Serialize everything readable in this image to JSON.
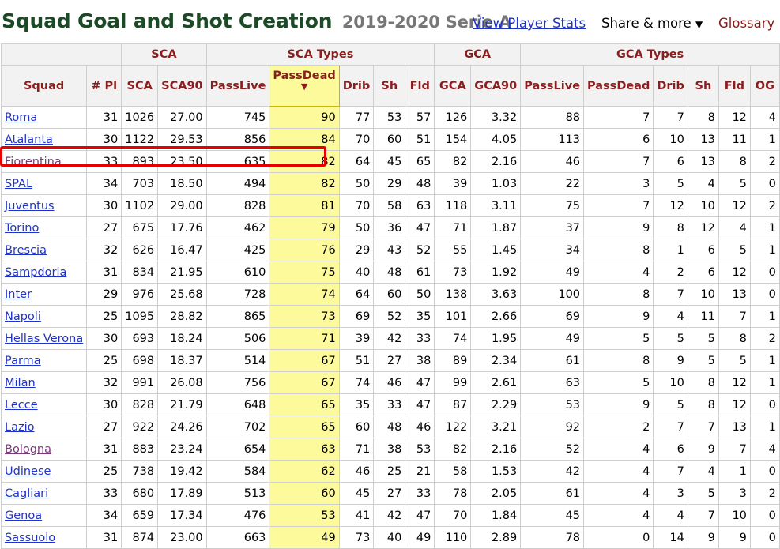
{
  "header": {
    "title": "Squad Goal and Shot Creation",
    "season": "2019-2020 Serie A",
    "view_player_stats": "View Player Stats",
    "share_more": "Share & more",
    "share_arrow": "▼",
    "glossary": "Glossary"
  },
  "table": {
    "groups": {
      "sca": "SCA",
      "sca_types": "SCA Types",
      "gca": "GCA",
      "gca_types": "GCA Types"
    },
    "columns": [
      "Squad",
      "# Pl",
      "SCA",
      "SCA90",
      "PassLive",
      "PassDead",
      "Drib",
      "Sh",
      "Fld",
      "GCA",
      "GCA90",
      "PassLive",
      "PassDead",
      "Drib",
      "Sh",
      "Fld",
      "OG"
    ],
    "sort_arrow": "▼",
    "rows": [
      [
        "Roma",
        "31",
        "1026",
        "27.00",
        "745",
        "90",
        "77",
        "53",
        "57",
        "126",
        "3.32",
        "88",
        "7",
        "7",
        "8",
        "12",
        "4"
      ],
      [
        "Atalanta",
        "30",
        "1122",
        "29.53",
        "856",
        "84",
        "70",
        "60",
        "51",
        "154",
        "4.05",
        "113",
        "6",
        "10",
        "13",
        "11",
        "1"
      ],
      [
        "Fiorentina",
        "33",
        "893",
        "23.50",
        "635",
        "82",
        "64",
        "45",
        "65",
        "82",
        "2.16",
        "46",
        "7",
        "6",
        "13",
        "8",
        "2"
      ],
      [
        "SPAL",
        "34",
        "703",
        "18.50",
        "494",
        "82",
        "50",
        "29",
        "48",
        "39",
        "1.03",
        "22",
        "3",
        "5",
        "4",
        "5",
        "0"
      ],
      [
        "Juventus",
        "30",
        "1102",
        "29.00",
        "828",
        "81",
        "70",
        "58",
        "63",
        "118",
        "3.11",
        "75",
        "7",
        "12",
        "10",
        "12",
        "2"
      ],
      [
        "Torino",
        "27",
        "675",
        "17.76",
        "462",
        "79",
        "50",
        "36",
        "47",
        "71",
        "1.87",
        "37",
        "9",
        "8",
        "12",
        "4",
        "1"
      ],
      [
        "Brescia",
        "32",
        "626",
        "16.47",
        "425",
        "76",
        "29",
        "43",
        "52",
        "55",
        "1.45",
        "34",
        "8",
        "1",
        "6",
        "5",
        "1"
      ],
      [
        "Sampdoria",
        "31",
        "834",
        "21.95",
        "610",
        "75",
        "40",
        "48",
        "61",
        "73",
        "1.92",
        "49",
        "4",
        "2",
        "6",
        "12",
        "0"
      ],
      [
        "Inter",
        "29",
        "976",
        "25.68",
        "728",
        "74",
        "64",
        "60",
        "50",
        "138",
        "3.63",
        "100",
        "8",
        "7",
        "10",
        "13",
        "0"
      ],
      [
        "Napoli",
        "25",
        "1095",
        "28.82",
        "865",
        "73",
        "69",
        "52",
        "35",
        "101",
        "2.66",
        "69",
        "9",
        "4",
        "11",
        "7",
        "1"
      ],
      [
        "Hellas Verona",
        "30",
        "693",
        "18.24",
        "506",
        "71",
        "39",
        "42",
        "33",
        "74",
        "1.95",
        "49",
        "5",
        "5",
        "5",
        "8",
        "2"
      ],
      [
        "Parma",
        "25",
        "698",
        "18.37",
        "514",
        "67",
        "51",
        "27",
        "38",
        "89",
        "2.34",
        "61",
        "8",
        "9",
        "5",
        "5",
        "1"
      ],
      [
        "Milan",
        "32",
        "991",
        "26.08",
        "756",
        "67",
        "74",
        "46",
        "47",
        "99",
        "2.61",
        "63",
        "5",
        "10",
        "8",
        "12",
        "1"
      ],
      [
        "Lecce",
        "30",
        "828",
        "21.79",
        "648",
        "65",
        "35",
        "33",
        "47",
        "87",
        "2.29",
        "53",
        "9",
        "5",
        "8",
        "12",
        "0"
      ],
      [
        "Lazio",
        "27",
        "922",
        "24.26",
        "702",
        "65",
        "60",
        "48",
        "46",
        "122",
        "3.21",
        "92",
        "2",
        "7",
        "7",
        "13",
        "1"
      ],
      [
        "Bologna",
        "31",
        "883",
        "23.24",
        "654",
        "63",
        "71",
        "38",
        "53",
        "82",
        "2.16",
        "52",
        "4",
        "6",
        "9",
        "7",
        "4"
      ],
      [
        "Udinese",
        "25",
        "738",
        "19.42",
        "584",
        "62",
        "46",
        "25",
        "21",
        "58",
        "1.53",
        "42",
        "4",
        "7",
        "4",
        "1",
        "0"
      ],
      [
        "Cagliari",
        "33",
        "680",
        "17.89",
        "513",
        "60",
        "45",
        "27",
        "33",
        "78",
        "2.05",
        "61",
        "4",
        "3",
        "5",
        "3",
        "2"
      ],
      [
        "Genoa",
        "34",
        "659",
        "17.34",
        "476",
        "53",
        "41",
        "42",
        "47",
        "70",
        "1.84",
        "45",
        "4",
        "4",
        "7",
        "10",
        "0"
      ],
      [
        "Sassuolo",
        "31",
        "874",
        "23.00",
        "663",
        "49",
        "73",
        "40",
        "49",
        "110",
        "2.89",
        "78",
        "0",
        "14",
        "9",
        "9",
        "0"
      ]
    ]
  }
}
